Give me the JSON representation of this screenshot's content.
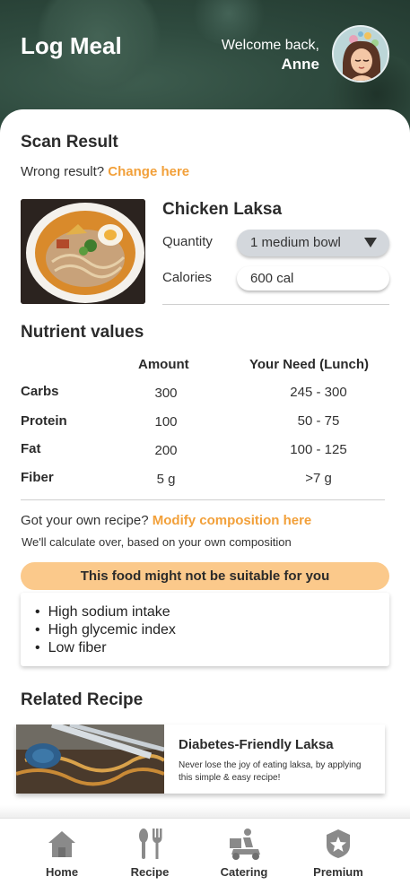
{
  "header": {
    "title": "Log Meal",
    "welcome": "Welcome back,",
    "user_name": "Anne"
  },
  "scan": {
    "heading": "Scan Result",
    "wrong_prompt": "Wrong result?",
    "change_link": "Change here",
    "food_name": "Chicken Laksa",
    "quantity_label": "Quantity",
    "quantity_value": "1 medium bowl",
    "calories_label": "Calories",
    "calories_value": "600 cal"
  },
  "nutrients": {
    "heading": "Nutrient values",
    "col_amount": "Amount",
    "col_need": "Your Need (Lunch)",
    "rows": [
      {
        "label": "Carbs",
        "amount": "300",
        "need": "245 - 300"
      },
      {
        "label": "Protein",
        "amount": "100",
        "need": "50 - 75"
      },
      {
        "label": "Fat",
        "amount": "200",
        "need": "100 - 125"
      },
      {
        "label": "Fiber",
        "amount": "5 g",
        "need": ">7 g"
      }
    ]
  },
  "recipe_prompt": {
    "question": "Got your own recipe?",
    "link": "Modify composition here",
    "note": "We'll calculate over, based on your own composition"
  },
  "warning": {
    "title": "This food might not be suitable for you",
    "items": [
      "High sodium intake",
      "High glycemic index",
      "Low fiber"
    ]
  },
  "related": {
    "heading": "Related Recipe",
    "title": "Diabetes-Friendly Laksa",
    "description": "Never lose the joy of eating laksa, by applying this simple & easy recipe!"
  },
  "nav": [
    {
      "label": "Home",
      "icon": "home-icon"
    },
    {
      "label": "Recipe",
      "icon": "fork-spoon-icon"
    },
    {
      "label": "Catering",
      "icon": "delivery-scooter-icon"
    },
    {
      "label": "Premium",
      "icon": "premium-badge-icon"
    }
  ],
  "colors": {
    "header_bg": "#2f4b3f",
    "accent": "#f2a03a",
    "warning_bg": "#fbc98b"
  }
}
